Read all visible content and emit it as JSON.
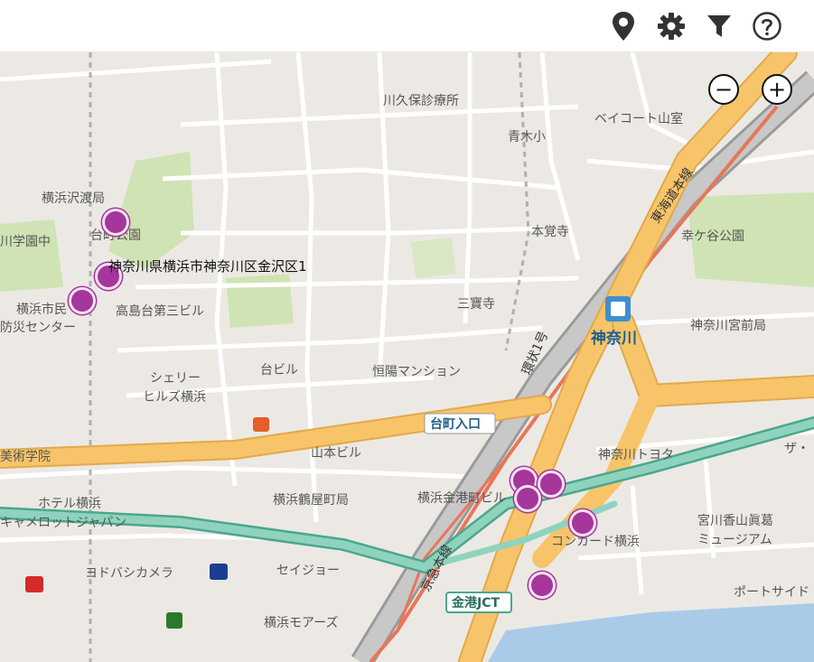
{
  "toolbar": {
    "icons": [
      "map-pin-icon",
      "gear-icon",
      "filter-icon",
      "help-icon"
    ]
  },
  "zoom": {
    "out_label": "−",
    "in_label": "+"
  },
  "address_label": "神奈川県横浜市神奈川区金沢区1",
  "markers": [
    {
      "name": "marker-1"
    },
    {
      "name": "marker-2"
    },
    {
      "name": "marker-3"
    },
    {
      "name": "marker-4"
    },
    {
      "name": "marker-5"
    },
    {
      "name": "marker-6"
    },
    {
      "name": "marker-7"
    },
    {
      "name": "marker-8"
    }
  ],
  "map_labels": {
    "kawakyu": "川久保診療所",
    "aoki": "青木小",
    "baycourt": "ベイコート山室",
    "tokaido": "東海道本線",
    "hongakuji": "本覚寺",
    "kogaya": "幸ケ谷公園",
    "sawatari": "横浜沢渡局",
    "daipark": "台町公園",
    "gakuen": "川学園中",
    "takashima": "高島台第三ビル",
    "shiminbo": "横浜市民",
    "bousai": "防災センター",
    "sanpoji": "三寶寺",
    "kanagawa_st": "神奈川",
    "miyamae": "神奈川宮前局",
    "kanjo": "環状1号",
    "sherry1": "シェリー",
    "sherry2": "ヒルズ横浜",
    "daibiru": "台ビル",
    "koyo": "恒陽マンション",
    "daimachi": "台町入口",
    "bijutsu": "美術学院",
    "yamamoto": "山本ビル",
    "toyota": "神奈川トヨタ",
    "kinko": "横浜金港町ビル",
    "tsuruya": "横浜鶴屋町局",
    "hotel": "ホテル横浜",
    "camelot": "キャメロットジャパン",
    "concord": "コンカード横浜",
    "miyagawa1": "宮川香山眞葛",
    "miyagawa2": "ミュージアム",
    "yodobashi": "ヨドバシカメラ",
    "seijo": "セイジョー",
    "keikyu": "京急本線",
    "kinko_jct": "金港JCT",
    "bortside": "ポートサイド",
    "more": "横浜モアーズ",
    "the": "ザ・"
  },
  "colors": {
    "marker": "#a5369b",
    "major_road": "#f7c46a",
    "toll_road": "#5fb8a0",
    "park": "#cfe3b4",
    "water": "#a9cbe8",
    "rail_red": "#e8765a"
  }
}
